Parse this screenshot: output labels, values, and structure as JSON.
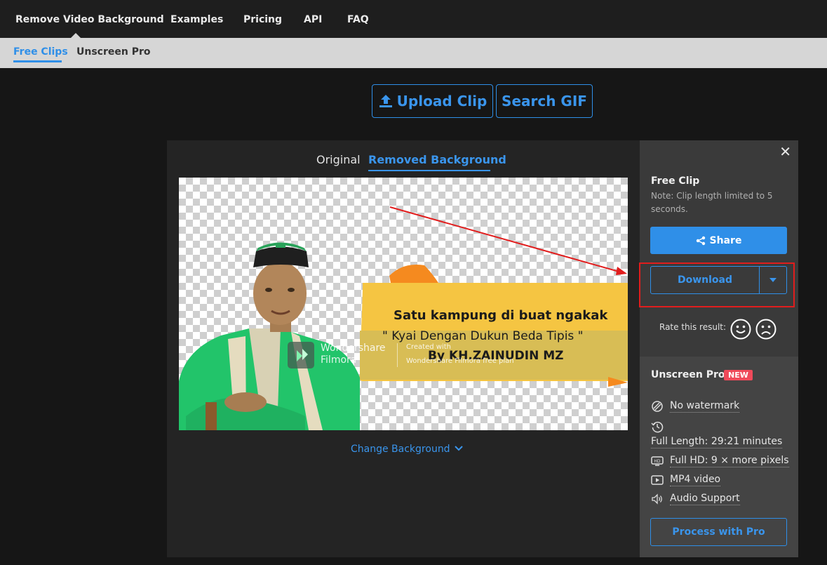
{
  "topnav": {
    "items": [
      "Remove Video Background",
      "Examples",
      "Pricing",
      "API",
      "FAQ"
    ]
  },
  "subnav": {
    "items": [
      "Free Clips",
      "Unscreen Pro"
    ]
  },
  "actions": {
    "upload_label": "Upload Clip",
    "search_label": "Search GIF"
  },
  "viewer": {
    "tab_original": "Original",
    "tab_removed": "Removed Background",
    "change_background": "Change Background",
    "video": {
      "line1": "Satu kampung di buat ngakak",
      "line2": "\" Kyai Dengan Dukun Beda Tipis \"",
      "line3": "By KH.ZAINUDIN MZ",
      "watermark_brand1": "Wondershare",
      "watermark_brand2": "Filmora",
      "watermark_created": "Created with",
      "watermark_plan": "Wondershare Filmora free plan"
    }
  },
  "sidebar": {
    "close_glyph": "✕",
    "free_title": "Free Clip",
    "note": "Note: Clip length limited to 5 seconds.",
    "share_label": "Share",
    "download_label": "Download",
    "rate_label": "Rate this result:",
    "pro": {
      "title": "Unscreen Pro",
      "badge": "NEW",
      "features": [
        {
          "icon": "no-watermark-icon",
          "label": "No watermark"
        },
        {
          "icon": "history-icon",
          "label": "Full Length: 29:21 minutes"
        },
        {
          "icon": "hd-icon",
          "label": "Full HD: 9 × more pixels"
        },
        {
          "icon": "video-file-icon",
          "label": "MP4 video"
        },
        {
          "icon": "speaker-icon",
          "label": "Audio Support"
        }
      ],
      "process_label": "Process with Pro"
    }
  },
  "colors": {
    "accent": "#2f8fe8",
    "highlight": "#e11d1d",
    "badge": "#ef4a5a"
  }
}
